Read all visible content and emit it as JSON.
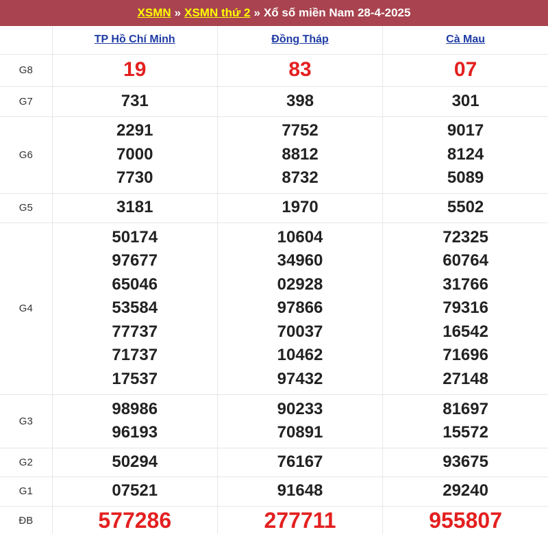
{
  "header": {
    "link1": "XSMN",
    "separator": "»",
    "link2": "XSMN thứ 2",
    "title": "Xổ số miền Nam 28-4-2025"
  },
  "provinces": [
    "TP Hồ Chí Minh",
    "Đồng Tháp",
    "Cà Mau"
  ],
  "prizes": [
    {
      "label": "G8",
      "values": [
        [
          "19"
        ],
        [
          "83"
        ],
        [
          "07"
        ]
      ]
    },
    {
      "label": "G7",
      "values": [
        [
          "731"
        ],
        [
          "398"
        ],
        [
          "301"
        ]
      ]
    },
    {
      "label": "G6",
      "values": [
        [
          "2291",
          "7000",
          "7730"
        ],
        [
          "7752",
          "8812",
          "8732"
        ],
        [
          "9017",
          "8124",
          "5089"
        ]
      ]
    },
    {
      "label": "G5",
      "values": [
        [
          "3181"
        ],
        [
          "1970"
        ],
        [
          "5502"
        ]
      ]
    },
    {
      "label": "G4",
      "values": [
        [
          "50174",
          "97677",
          "65046",
          "53584",
          "77737",
          "71737",
          "17537"
        ],
        [
          "10604",
          "34960",
          "02928",
          "97866",
          "70037",
          "10462",
          "97432"
        ],
        [
          "72325",
          "60764",
          "31766",
          "79316",
          "16542",
          "71696",
          "27148"
        ]
      ]
    },
    {
      "label": "G3",
      "values": [
        [
          "98986",
          "96193"
        ],
        [
          "90233",
          "70891"
        ],
        [
          "81697",
          "15572"
        ]
      ]
    },
    {
      "label": "G2",
      "values": [
        [
          "50294"
        ],
        [
          "76167"
        ],
        [
          "93675"
        ]
      ]
    },
    {
      "label": "G1",
      "values": [
        [
          "07521"
        ],
        [
          "91648"
        ],
        [
          "29240"
        ]
      ]
    },
    {
      "label": "ĐB",
      "values": [
        [
          "577286"
        ],
        [
          "277711"
        ],
        [
          "955807"
        ]
      ]
    }
  ],
  "colors": {
    "header_bg": "#a8434f",
    "header_link": "#ffff00",
    "province_link": "#1d3ba3",
    "highlight": "#e41f1f"
  }
}
